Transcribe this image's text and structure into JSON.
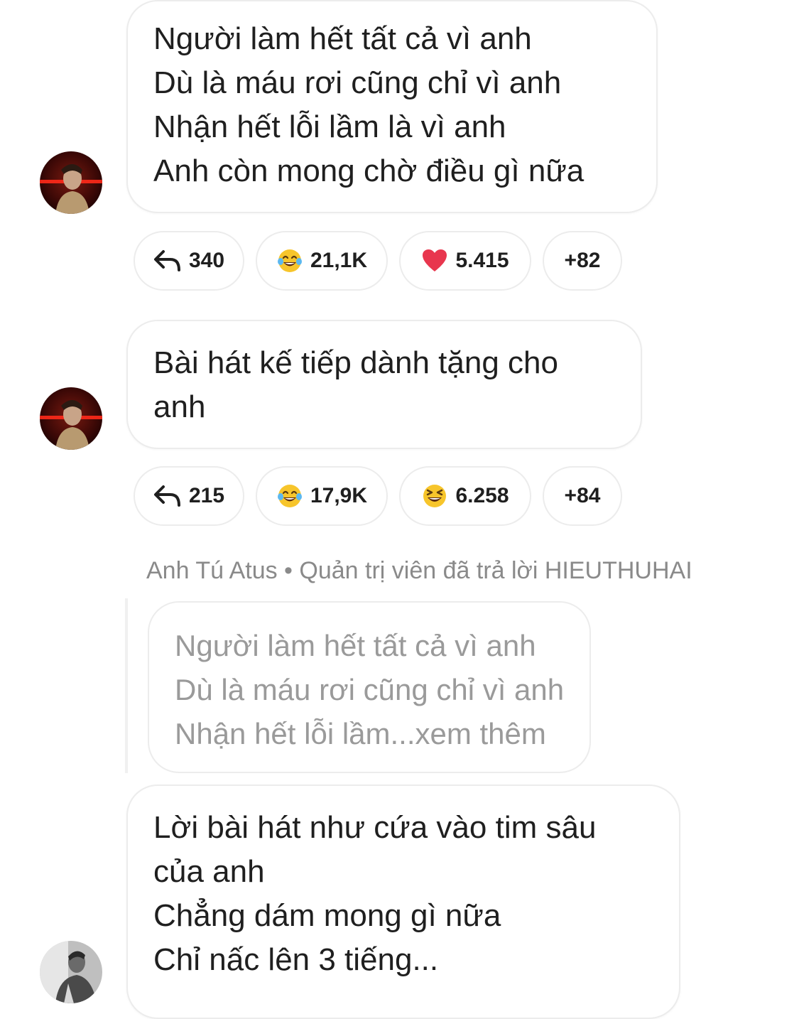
{
  "comments": [
    {
      "lines": [
        "Người làm hết tất cả vì anh",
        "Dù là máu rơi cũng chỉ vì anh",
        "Nhận hết lỗi lầm là vì anh",
        "Anh còn mong chờ điều gì nữa"
      ],
      "reactions": {
        "reply_count": "340",
        "first_count": "21,1K",
        "second_count": "5.415",
        "more": "+82"
      },
      "first_icon": "laugh-cry-emoji-icon",
      "second_icon": "heart-icon"
    },
    {
      "lines": [
        "Bài hát kế tiếp dành tặng cho",
        "anh"
      ],
      "reactions": {
        "reply_count": "215",
        "first_count": "17,9K",
        "second_count": "6.258",
        "more": "+84"
      },
      "first_icon": "laugh-cry-emoji-icon",
      "second_icon": "grin-squint-emoji-icon"
    }
  ],
  "admin_reply": {
    "meta": "Anh Tú Atus • Quản trị viên đã trả lời HIEUTHUHAI",
    "quoted_lines": [
      "Người làm hết tất cả vì anh",
      "Dù là máu rơi cũng chỉ vì anh",
      "Nhận hết lỗi lầm...xem thêm"
    ]
  },
  "last_comment": {
    "lines": [
      "Lời bài hát như cứa vào tim sâu",
      "của anh",
      "Chẳng dám mong gì nữa",
      "Chỉ nấc lên 3 tiếng..."
    ]
  },
  "colors": {
    "bubble_border": "#ececec",
    "meta_text": "#8a8a8a",
    "quoted_text": "#9a9a9a",
    "heart": "#e8364e",
    "emoji_yellow": "#f7c52b"
  }
}
